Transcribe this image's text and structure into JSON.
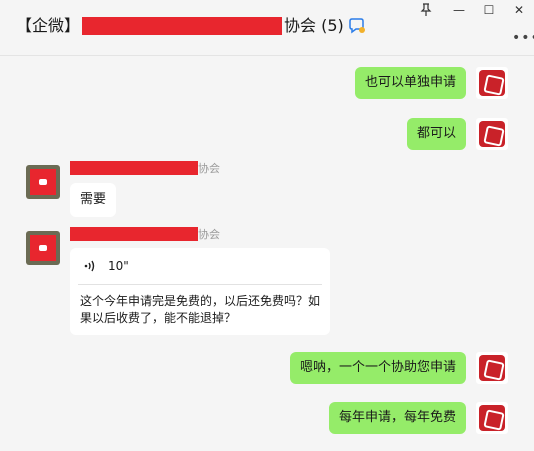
{
  "window": {
    "title_prefix": "【企微】",
    "title_suffix": "协会 (5)",
    "minimize_glyph": "—",
    "maximize_glyph": "☐",
    "close_glyph": "✕",
    "more_glyph": "•••"
  },
  "messages": [
    {
      "side": "right",
      "text": "也可以单独申请"
    },
    {
      "side": "right",
      "text": "都可以"
    },
    {
      "side": "left",
      "sender_suffix": "协会",
      "text": "需要"
    },
    {
      "side": "left",
      "sender_suffix": "协会",
      "voice": {
        "duration": "10\"",
        "transcript": "这个今年申请完是免费的，以后还免费吗？如果以后收费了，能不能退掉？"
      }
    },
    {
      "side": "right",
      "text": "嗯呐，一个一个协助您申请"
    },
    {
      "side": "right",
      "text": "每年申请，每年免费"
    }
  ],
  "colors": {
    "bubble_self": "#95ec69",
    "redaction": "#e8262e",
    "seal": "#c92229"
  }
}
